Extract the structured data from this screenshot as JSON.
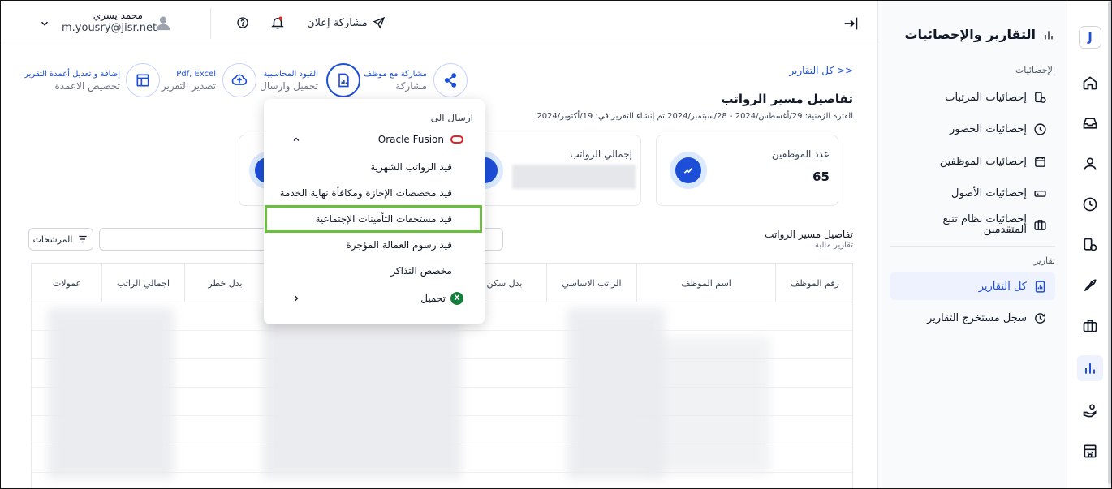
{
  "rail": {
    "logo": "J",
    "items": [
      "home-icon",
      "inbox-icon",
      "user-icon",
      "clock-icon",
      "payroll-icon",
      "rocket-icon",
      "briefcase-icon",
      "chart-icon",
      "hand-coin-icon",
      "building-icon"
    ],
    "active": "chart-icon"
  },
  "sidebar": {
    "title": "التقارير والإحصائيات",
    "section_stats": "الإحصائيات",
    "stats_items": [
      {
        "label": "إحصائيات المرتبات"
      },
      {
        "label": "إحصائيات الحضور"
      },
      {
        "label": "إحصائيات الموظفين"
      },
      {
        "label": "إحصائيات الأصول"
      },
      {
        "label": "إحصائيات نظام تتبع",
        "label2": "المتقدمين"
      }
    ],
    "section_reports": "تقارير",
    "reports_items": [
      {
        "label": "كل التقارير"
      },
      {
        "label": "سجل مستخرج التقارير"
      }
    ]
  },
  "topbar": {
    "share_ad": "مشاركة إعلان",
    "user_name": "محمد يسري",
    "user_email": "m.yousry@jisr.net"
  },
  "page": {
    "back_link": "<< كل التقارير",
    "title": "تفاصيل مسير الرواتب",
    "period": "الفترة الزمنية: 29/أغسطس/2024 - 28/سبتمبر/2024 تم إنشاء التقرير في: 19/أكتوبر/2024"
  },
  "actions": [
    {
      "top": "مشاركة مع موظف",
      "bottom": "مشاركة"
    },
    {
      "top": "القيود المحاسبية",
      "bottom": "تحميل وارسال"
    },
    {
      "top": "Pdf, Excel",
      "bottom": "تصدير التقرير"
    },
    {
      "top": "إضافة و تعديل أعمدة التقرير",
      "bottom": "تخصيص الاعمدة"
    }
  ],
  "cards": [
    {
      "label": "عدد الموظفين",
      "value": "65"
    },
    {
      "label": "إجمالي الرواتب",
      "value": ""
    }
  ],
  "table": {
    "title": "تفاصيل مسير الرواتب",
    "subtitle": "تقارير مالية",
    "filters_label": "المرشحات",
    "columns": [
      "رقم الموظف",
      "اسم الموظف",
      "الراتب الاساسي",
      "بدل سكن",
      "بدل خطر",
      "اجمالي الراتب",
      "عمولات"
    ]
  },
  "menu": {
    "header": "ارسال الى",
    "oracle_label": "Oracle Fusion",
    "items": [
      "قيد الرواتب الشهرية",
      "قيد مخصصات الإجازة ومكافأة نهاية الخدمة",
      "قيد مستحقات التأمينات الإجتماعية",
      "قيد رسوم العمالة المؤجرة",
      "مخصص التذاكر"
    ],
    "download_label": "تحميل"
  }
}
